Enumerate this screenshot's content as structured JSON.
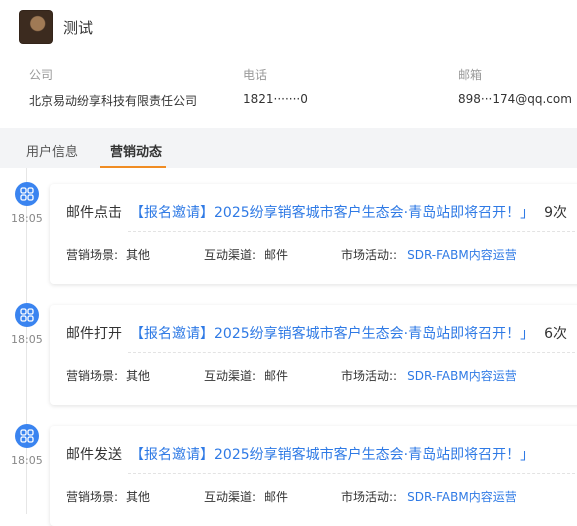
{
  "user": {
    "name": "测试"
  },
  "info": {
    "company_label": "公司",
    "company_value": "北京易动纷享科技有限责任公司",
    "phone_label": "电话",
    "phone_value": "1821·······0",
    "email_label": "邮箱",
    "email_value": "898···174@qq.com"
  },
  "tabs": [
    {
      "label": "用户信息"
    },
    {
      "label": "营销动态"
    }
  ],
  "events": [
    {
      "time": "18:05",
      "action": "邮件点击",
      "link": "【报名邀请】2025纷享销客城市客户生态会·青岛站即将召开！」",
      "count": "9次",
      "scene_label": "营销场景:",
      "scene_value": "其他",
      "channel_label": "互动渠道:",
      "channel_value": "邮件",
      "campaign_label": "市场活动::",
      "campaign_value": "SDR-FABM内容运营"
    },
    {
      "time": "18:05",
      "action": "邮件打开",
      "link": "【报名邀请】2025纷享销客城市客户生态会·青岛站即将召开！」",
      "count": "6次",
      "scene_label": "营销场景:",
      "scene_value": "其他",
      "channel_label": "互动渠道:",
      "channel_value": "邮件",
      "campaign_label": "市场活动::",
      "campaign_value": "SDR-FABM内容运营"
    },
    {
      "time": "18:05",
      "action": "邮件发送",
      "link": "【报名邀请】2025纷享销客城市客户生态会·青岛站即将召开！」",
      "count": "",
      "scene_label": "营销场景:",
      "scene_value": "其他",
      "channel_label": "互动渠道:",
      "channel_value": "邮件",
      "campaign_label": "市场活动::",
      "campaign_value": "SDR-FABM内容运营"
    }
  ],
  "colors": {
    "accent": "#2f7ae5",
    "tab_active": "#f08c23"
  },
  "icons": {
    "event": "grid-apps-icon"
  }
}
